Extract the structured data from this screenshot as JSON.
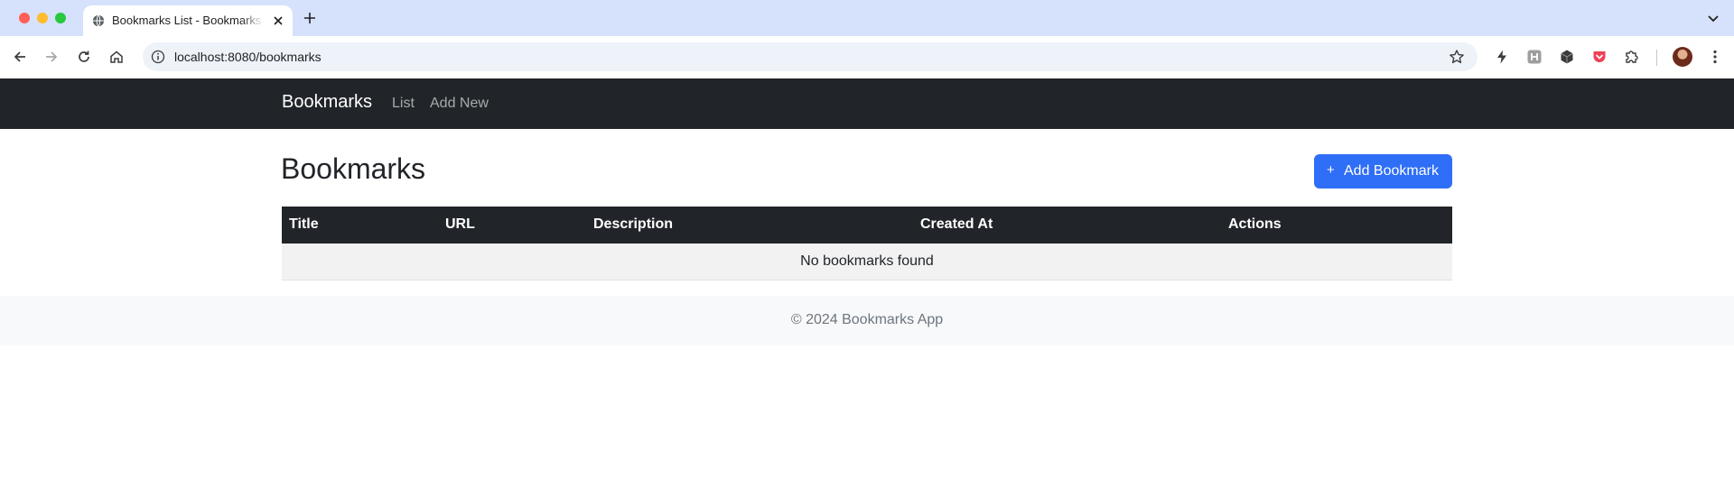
{
  "browser": {
    "tab_title": "Bookmarks List - Bookmarks App",
    "url": "localhost:8080/bookmarks",
    "icons": [
      "globe-icon",
      "close-icon",
      "plus-icon",
      "chevron-down-icon",
      "back-icon",
      "forward-icon",
      "reload-icon",
      "home-icon",
      "info-icon",
      "star-icon",
      "extension-icons",
      "puzzle-icon",
      "kebab-icon"
    ]
  },
  "navbar": {
    "brand": "Bookmarks",
    "links": [
      {
        "label": "List"
      },
      {
        "label": "Add New"
      }
    ]
  },
  "main": {
    "title": "Bookmarks",
    "add_button": {
      "icon": "+",
      "label": "Add Bookmark"
    },
    "table": {
      "columns": [
        "Title",
        "URL",
        "Description",
        "Created At",
        "Actions"
      ],
      "empty_message": "No bookmarks found"
    }
  },
  "footer": {
    "text": "© 2024 Bookmarks App"
  },
  "colors": {
    "navbar_bg": "#212529",
    "primary": "#2f6ef6",
    "tabbar_bg": "#d6e2fb"
  }
}
